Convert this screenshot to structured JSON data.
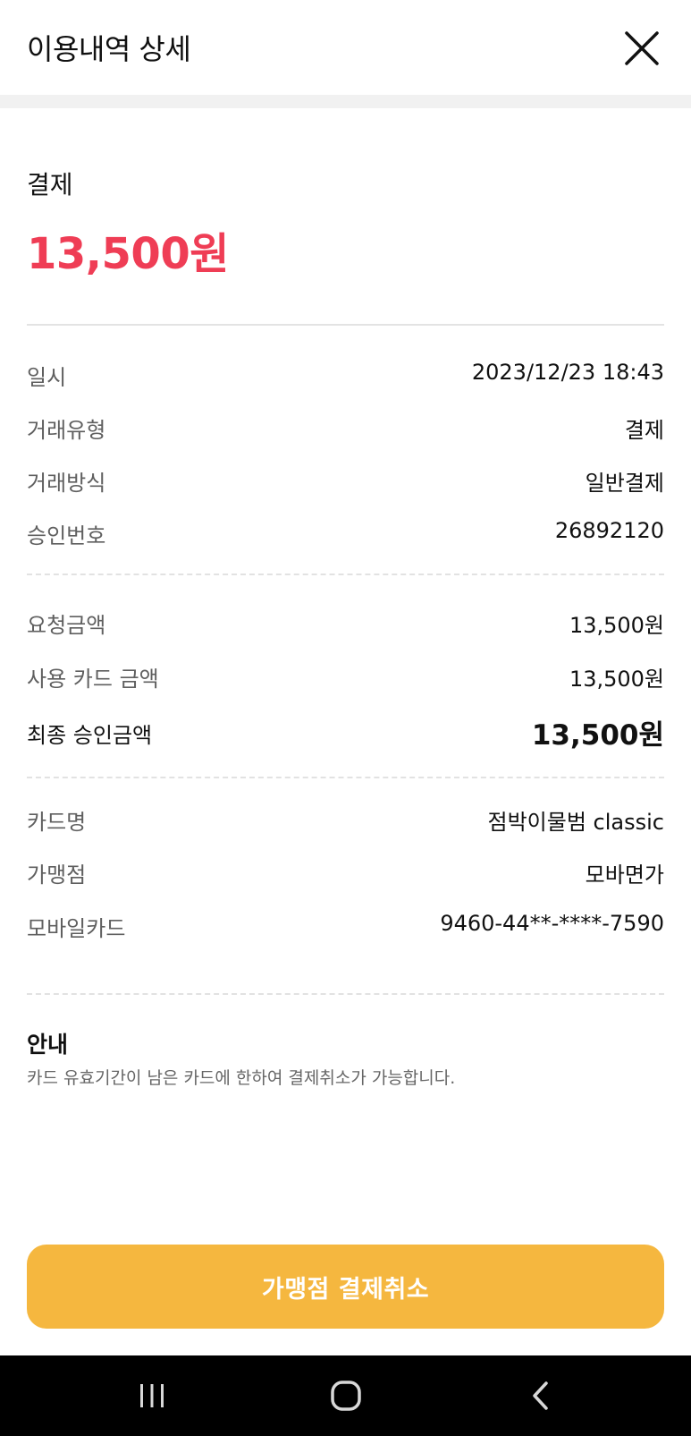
{
  "header": {
    "title": "이용내역 상세",
    "close_icon": "close-icon"
  },
  "summary": {
    "label": "결제",
    "amount": "13,500원",
    "amount_color": "#ef3d55"
  },
  "section1": [
    {
      "label": "일시",
      "value": "2023/12/23 18:43"
    },
    {
      "label": "거래유형",
      "value": "결제"
    },
    {
      "label": "거래방식",
      "value": "일반결제"
    },
    {
      "label": "승인번호",
      "value": "26892120"
    }
  ],
  "section2": [
    {
      "label": "요청금액",
      "value": "13,500원"
    },
    {
      "label": "사용 카드 금액",
      "value": "13,500원"
    },
    {
      "label": "최종 승인금액",
      "value": "13,500원"
    }
  ],
  "section3": [
    {
      "label": "카드명",
      "value": "점박이물범 classic"
    },
    {
      "label": "가맹점",
      "value": "모바면가"
    },
    {
      "label": "모바일카드",
      "value": "9460-44**-****-7590"
    }
  ],
  "notice": {
    "title": "안내",
    "text": "카드 유효기간이 남은 카드에 한하여 결제취소가 가능합니다."
  },
  "cancel_button": {
    "label": "가맹점 결제취소",
    "color": "#f5b73f"
  },
  "navbar": {
    "recent_icon": "recent-apps-icon",
    "home_icon": "home-icon",
    "back_icon": "back-icon"
  }
}
